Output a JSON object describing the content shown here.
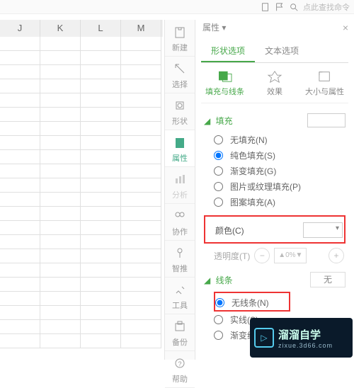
{
  "topbar": {
    "search_placeholder": "点此查找命令"
  },
  "sheet": {
    "cols": [
      "J",
      "K",
      "L",
      "M"
    ]
  },
  "strip": {
    "items": [
      {
        "label": "新建"
      },
      {
        "label": "选择"
      },
      {
        "label": "形状"
      },
      {
        "label": "属性"
      },
      {
        "label": "分析"
      },
      {
        "label": "协作"
      },
      {
        "label": "智推"
      },
      {
        "label": "工具"
      },
      {
        "label": "备份"
      },
      {
        "label": "帮助"
      }
    ]
  },
  "panel": {
    "title": "属性",
    "tab_shape": "形状选项",
    "tab_text": "文本选项",
    "sub_fill": "填充与线条",
    "sub_effect": "效果",
    "sub_size": "大小与属性",
    "fill_section": "填充",
    "fill_none": "无填充(N)",
    "fill_solid": "纯色填充(S)",
    "fill_gradient": "渐变填充(G)",
    "fill_picture": "图片或纹理填充(P)",
    "fill_pattern": "图案填充(A)",
    "color_label": "颜色(C)",
    "opacity_label": "透明度(T)",
    "opacity_value": "▲0%▼",
    "line_section": "线条",
    "line_default": "无",
    "line_none": "无线条(N)",
    "line_solid": "实线(S)",
    "line_gradient": "渐变线(G)"
  },
  "watermark": {
    "name": "溜溜自学",
    "url": "zixue.3d66.com"
  }
}
